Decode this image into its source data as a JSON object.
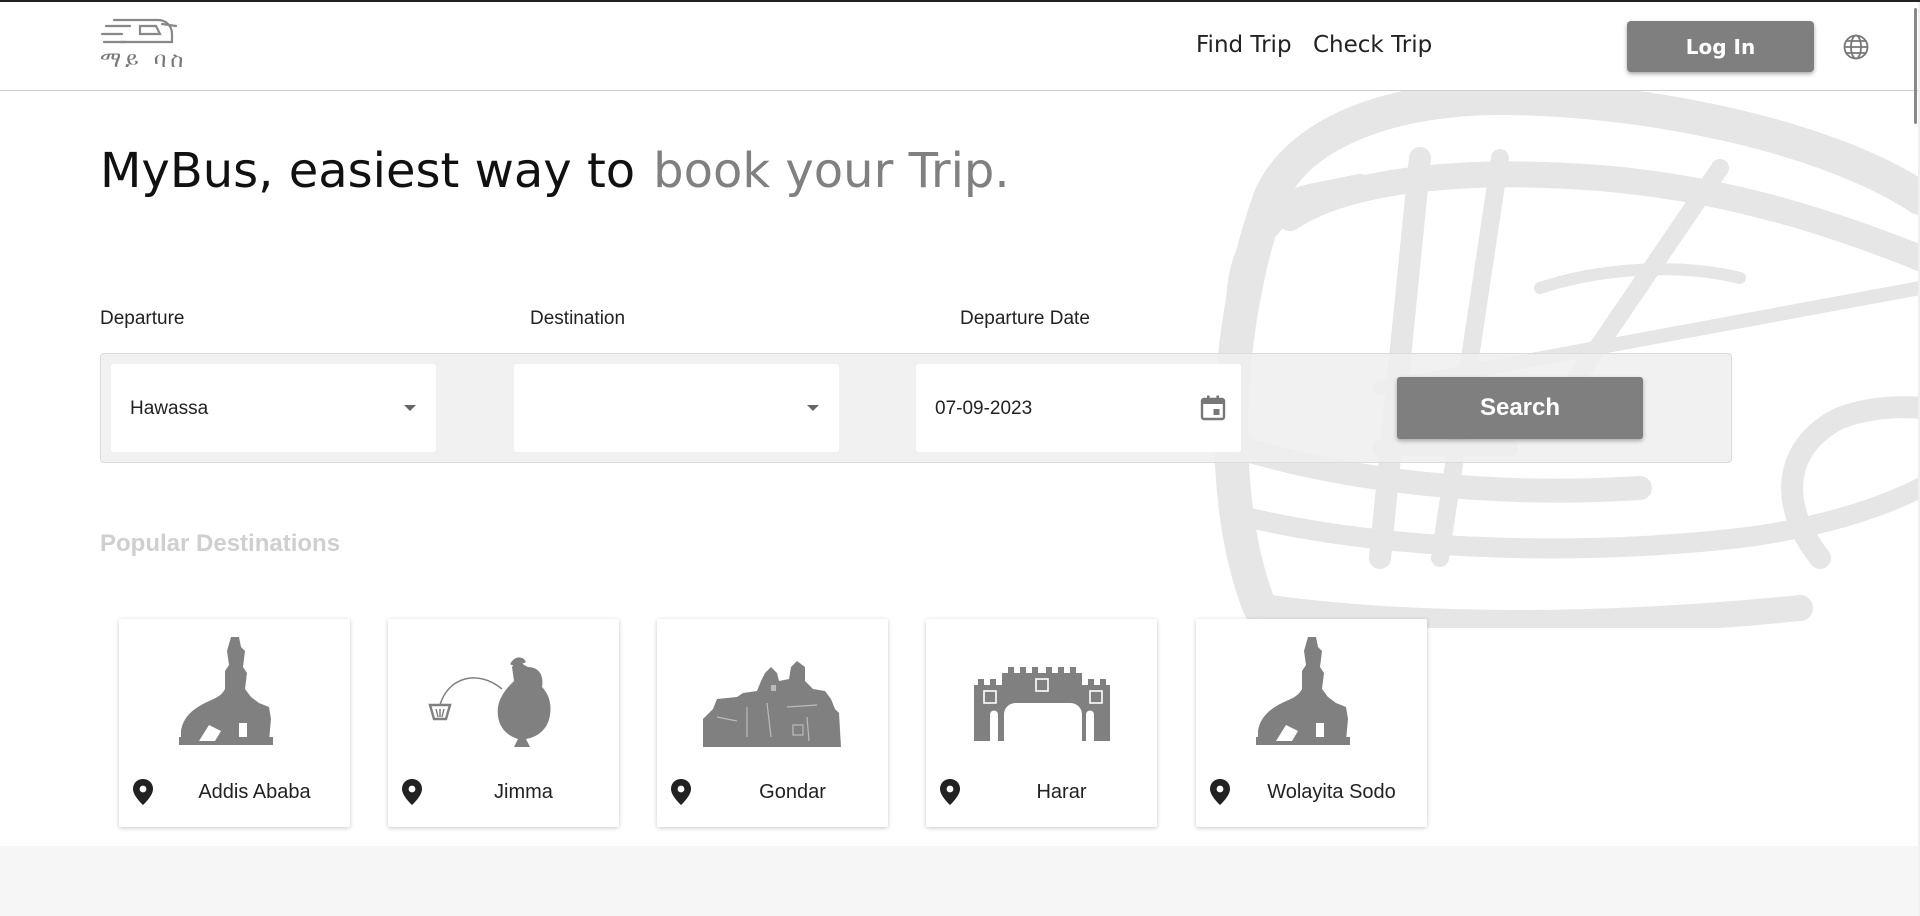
{
  "header": {
    "logo_text": "ማይ ባስ",
    "nav": [
      {
        "label": "Find Trip"
      },
      {
        "label": "Check Trip"
      }
    ],
    "login_label": "Log In",
    "globe_icon": "globe-icon"
  },
  "hero": {
    "line_dark": "MyBus, easiest way to",
    "line_light": "book your Trip."
  },
  "form": {
    "departure_label": "Departure",
    "destination_label": "Destination",
    "date_label": "Departure Date",
    "departure_value": "Hawassa",
    "destination_value": "",
    "date_value": "07-09-2023",
    "search_label": "Search"
  },
  "popular": {
    "title": "Popular Destinations",
    "cards": [
      {
        "name": "Addis Ababa",
        "icon": "lion-statue-icon"
      },
      {
        "name": "Jimma",
        "icon": "coffee-pot-icon"
      },
      {
        "name": "Gondar",
        "icon": "castle-icon"
      },
      {
        "name": "Harar",
        "icon": "city-gate-icon"
      },
      {
        "name": "Wolayita Sodo",
        "icon": "lion-statue-icon"
      }
    ]
  },
  "colors": {
    "accent": "#7f7f7f",
    "muted_text": "#808080",
    "faint_title": "#cfcfcf"
  }
}
